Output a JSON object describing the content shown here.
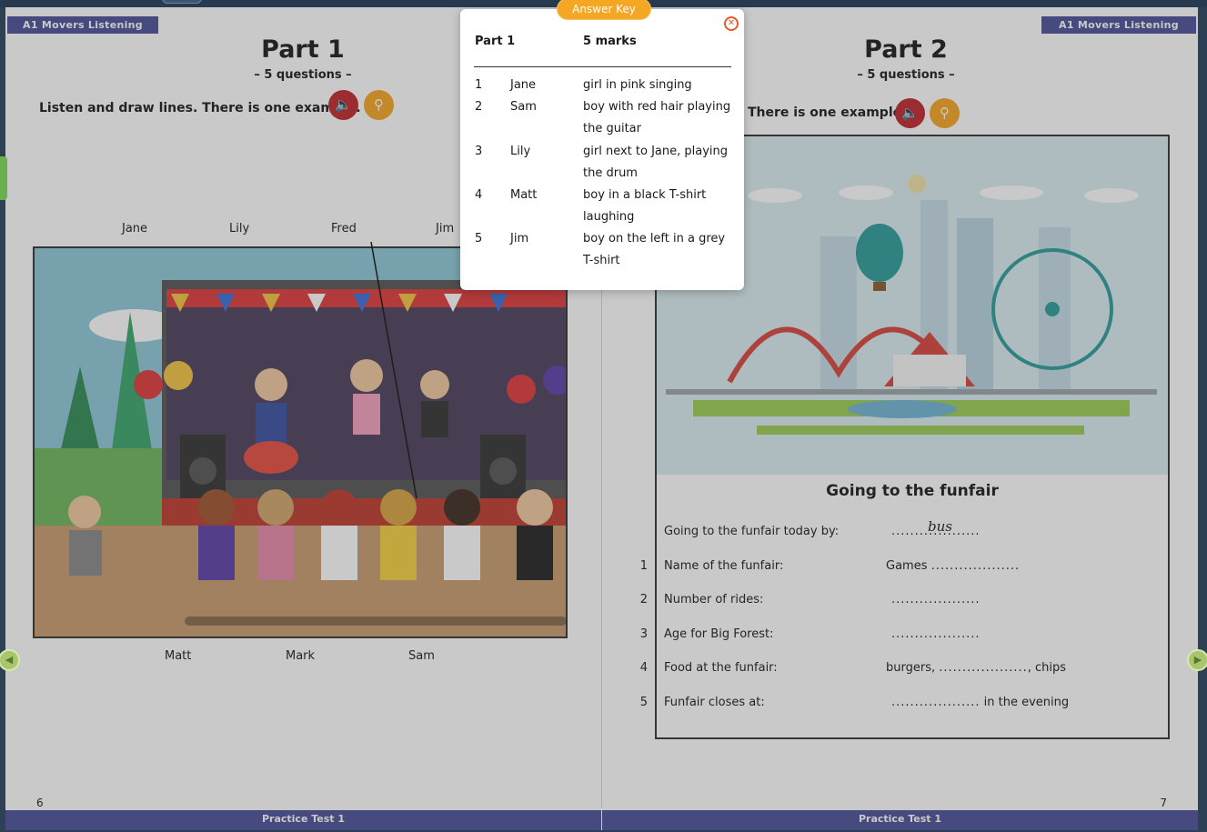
{
  "header": {
    "left_tag": "A1 Movers Listening",
    "right_tag": "A1 Movers Listening"
  },
  "part1": {
    "title": "Part 1",
    "subtitle": "– 5 questions –",
    "instruction": "Listen and draw lines. There is one example.",
    "names_top": [
      "Jane",
      "Lily",
      "Fred",
      "Jim"
    ],
    "names_bottom": [
      "Matt",
      "Mark",
      "Sam"
    ],
    "page_number": "6",
    "footer": "Practice Test 1"
  },
  "part2": {
    "title": "Part 2",
    "subtitle": "– 5 questions –",
    "instruction": "There is one example.",
    "heading": "Going to the funfair",
    "example": {
      "label": "Going to the funfair today by:",
      "answer": "bus",
      "dots": "..................."
    },
    "questions": [
      {
        "num": "1",
        "label": "Name of the funfair:",
        "prefix": "Games ",
        "dots": "...................",
        "suffix": ""
      },
      {
        "num": "2",
        "label": "Number of rides:",
        "prefix": "",
        "dots": "...................",
        "suffix": ""
      },
      {
        "num": "3",
        "label": "Age for Big Forest:",
        "prefix": "",
        "dots": "...................",
        "suffix": ""
      },
      {
        "num": "4",
        "label": "Food at the funfair:",
        "prefix": "burgers, ",
        "dots": "...................",
        "suffix": ", chips"
      },
      {
        "num": "5",
        "label": "Funfair closes at:",
        "prefix": "",
        "dots": "...................",
        "suffix": " in the evening"
      }
    ],
    "page_number": "7",
    "footer": "Practice Test 1"
  },
  "answer_key": {
    "tab_label": "Answer Key",
    "close_icon": "close-icon",
    "head_left": "Part 1",
    "head_right": "5 marks",
    "rows": [
      {
        "num": "1",
        "name": "Jane",
        "desc": "girl in pink singing"
      },
      {
        "num": "2",
        "name": "Sam",
        "desc": "boy with red hair playing the guitar"
      },
      {
        "num": "3",
        "name": "Lily",
        "desc": "girl next to Jane, playing the drum"
      },
      {
        "num": "4",
        "name": "Matt",
        "desc": "boy in a black T-shirt laughing"
      },
      {
        "num": "5",
        "name": "Jim",
        "desc": "boy on the left in a grey T-shirt"
      }
    ]
  },
  "icons": {
    "audio": "speaker-icon",
    "key": "key-icon",
    "prev": "chevron-left-icon",
    "next": "chevron-right-icon"
  },
  "colors": {
    "brand": "#4a5097",
    "audio": "#c0272d",
    "key": "#f5a623",
    "close": "#e85a2e"
  }
}
